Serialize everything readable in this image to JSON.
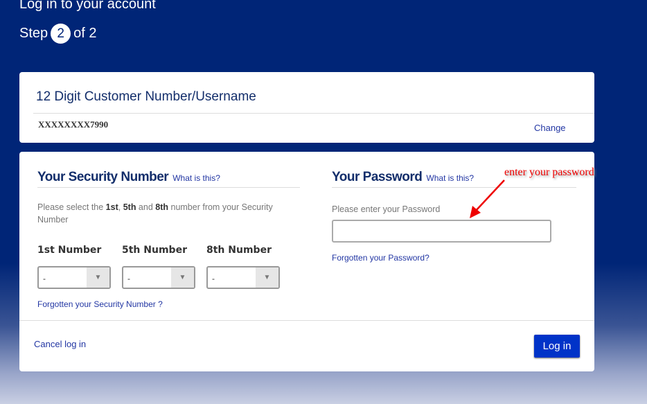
{
  "header": {
    "title": "Log in to your account",
    "step_prefix": "Step",
    "step_current": "2",
    "step_suffix": "of 2"
  },
  "customer": {
    "title": "12 Digit Customer Number/Username",
    "value": "XXXXXXXX7990",
    "change_label": "Change"
  },
  "security": {
    "title": "Your Security Number",
    "what_label": "What is this?",
    "desc_1": "Please select the ",
    "b1": "1st",
    "desc_2": ", ",
    "b2": "5th",
    "desc_3": " and ",
    "b3": "8th",
    "desc_4": " number from your Security Number",
    "fields": [
      {
        "label": "1st Number",
        "value": "-"
      },
      {
        "label": "5th Number",
        "value": "-"
      },
      {
        "label": "8th Number",
        "value": "-"
      }
    ],
    "forgot_label": "Forgotten your Security Number ?"
  },
  "password": {
    "title": "Your Password",
    "what_label": "What is this?",
    "prompt": "Please enter your Password",
    "value": "",
    "forgot_label": "Forgotten your Password?"
  },
  "footer": {
    "cancel_label": "Cancel log in",
    "login_label": "Log in"
  },
  "annotation": {
    "text": "enter your password",
    "color": "#e00000"
  }
}
